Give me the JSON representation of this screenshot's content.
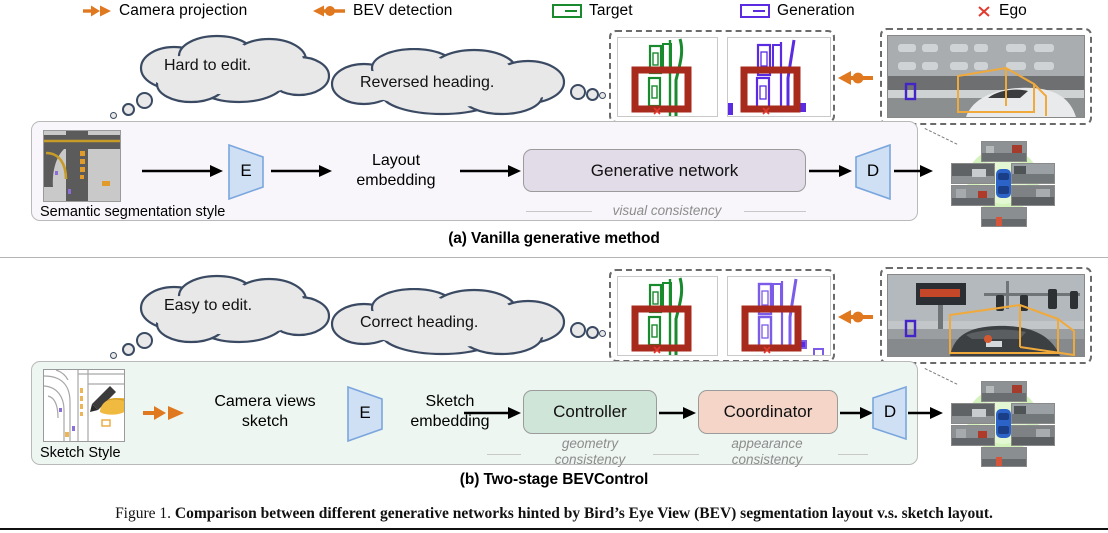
{
  "legend": {
    "items": [
      {
        "icon": "camera-projection-arrow-icon",
        "label": "Camera projection",
        "color": "#e07820"
      },
      {
        "icon": "bev-detection-arrow-icon",
        "label": "BEV detection",
        "color": "#e07820"
      },
      {
        "icon": "target-box-icon",
        "label": "Target",
        "color": "#1a8a2e"
      },
      {
        "icon": "generation-box-icon",
        "label": "Generation",
        "color": "#5a2be0"
      },
      {
        "icon": "ego-cross-icon",
        "label": "Ego",
        "color": "#e03a2f"
      }
    ]
  },
  "panel_a": {
    "caption": "(a) Vanilla generative method",
    "thumbnail_caption": "Semantic segmentation style",
    "thumbnail_name": "bev-semantic-segmentation-thumbnail",
    "encoder_letter": "E",
    "decoder_letter": "D",
    "embedding_label": "Layout\nembedding",
    "embedding_line1": "Layout",
    "embedding_line2": "embedding",
    "network_label": "Generative network",
    "network_color": "#e2dbe8",
    "consistency_label": "visual consistency",
    "clouds": [
      {
        "text": "Hard to edit."
      },
      {
        "text": "Reversed heading."
      }
    ],
    "bev_compare": {
      "target_view_name": "bev-target-view",
      "generation_view_name": "bev-generation-view",
      "target_color": "#1a8a2e",
      "generation_color": "#5a2be0",
      "highlight_color": "#a72a1d",
      "ego_marker": "×"
    },
    "camera_view_name": "camera-view-reversed-heading",
    "bbox_color": "#f0a93b",
    "multiview_name": "multiview-camera-output"
  },
  "panel_b": {
    "caption": "(b) Two-stage BEVControl",
    "thumbnail_caption": "Sketch Style",
    "thumbnail_name": "bev-sketch-thumbnail",
    "encoder_letter": "E",
    "decoder_letter": "D",
    "camera_views_line1": "Camera views",
    "camera_views_line2": "sketch",
    "embedding_line1": "Sketch",
    "embedding_line2": "embedding",
    "stage1_label": "Controller",
    "stage1_color": "#cfe5d8",
    "stage1_consistency_line1": "geometry",
    "stage1_consistency_line2": "consistency",
    "stage2_label": "Coordinator",
    "stage2_color": "#f5d5c8",
    "stage2_consistency_line1": "appearance",
    "stage2_consistency_line2": "consistency",
    "clouds": [
      {
        "text": "Easy to edit."
      },
      {
        "text": "Correct heading."
      }
    ],
    "bev_compare": {
      "target_view_name": "bev-target-view",
      "generation_view_name": "bev-generation-view",
      "target_color": "#1a8a2e",
      "generation_color": "#5a2be0",
      "highlight_color": "#a72a1d",
      "ego_marker": "×"
    },
    "camera_view_name": "camera-view-correct-heading",
    "bbox_color": "#f0a93b",
    "multiview_name": "multiview-camera-output"
  },
  "figure_caption": {
    "prefix": "Figure 1.",
    "bold_text": "Comparison between different generative networks hinted by Bird’s Eye View (BEV) segmentation layout v.s. sketch layout."
  }
}
